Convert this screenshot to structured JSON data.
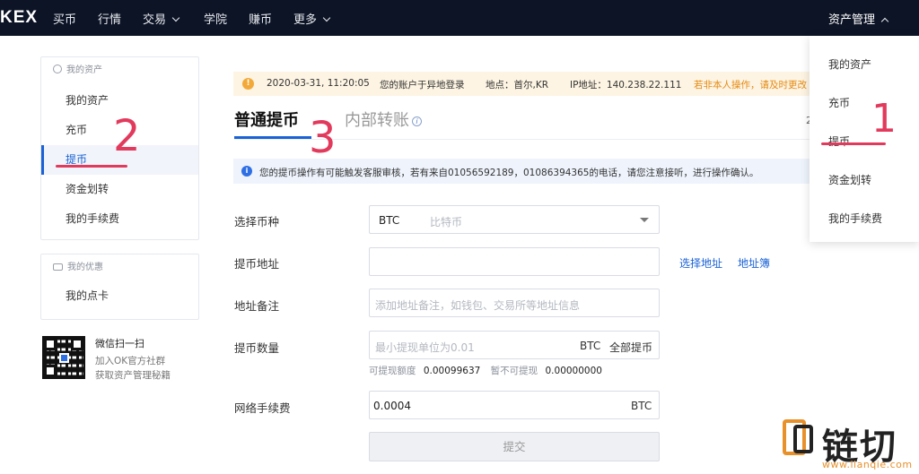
{
  "nav": {
    "logo": "KEX",
    "items": [
      "买币",
      "行情",
      "交易",
      "学院",
      "赚币",
      "更多"
    ],
    "asset_mgmt": "资产管理"
  },
  "sidebar": {
    "section1_title": "我的资产",
    "items": [
      "我的资产",
      "充币",
      "提币",
      "资金划转",
      "我的手续费"
    ],
    "active": "提币",
    "section2_title": "我的优惠",
    "items2": [
      "我的点卡"
    ],
    "wechat": {
      "title": "微信扫一扫",
      "line1": "加入OK官方社群",
      "line2": "获取资产管理秘籍"
    }
  },
  "alert": {
    "time": "2020-03-31, 11:20:05",
    "msg": "您的账户于异地登录",
    "location": "地点：首尔,KR",
    "ip": "IP地址：140.238.22.111",
    "link": "若非本人操作，请及时更改"
  },
  "tabs": {
    "normal": "普通提币",
    "internal": "内部转账",
    "right": "2"
  },
  "notice": "您的提币操作有可能触发客服审核，若有来自01056592189，01086394365的电话，请您注意接听，进行操作确认。",
  "form": {
    "coin_label": "选择币种",
    "coin_value": "BTC",
    "coin_name": "比特币",
    "address_label": "提币地址",
    "select_address": "选择地址",
    "address_book": "地址簿",
    "remark_label": "地址备注",
    "remark_placeholder": "添加地址备注，如钱包、交易所等地址信息",
    "amount_label": "提币数量",
    "amount_placeholder": "最小提现单位为0.01",
    "amount_unit": "BTC",
    "withdraw_all": "全部提币",
    "available_label": "可提现额度",
    "available_value": "0.00099637",
    "frozen_label": "暂不可提现",
    "frozen_value": "0.00000000",
    "fee_label": "网络手续费",
    "fee_value": "0.0004",
    "fee_unit": "BTC",
    "submit": "提交"
  },
  "dropdown": [
    "我的资产",
    "充币",
    "提币",
    "资金划转",
    "我的手续费"
  ],
  "annotations": {
    "n1": "1",
    "n2": "2",
    "n3": "3",
    "color": "#e23a5c"
  },
  "watermark": {
    "text": "链切",
    "url": "www.lianqie.com"
  }
}
